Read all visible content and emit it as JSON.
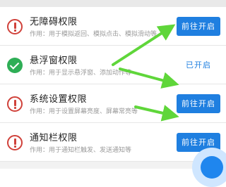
{
  "permissions": [
    {
      "title": "无障碍权限",
      "desc": "作用：用于模拟返回、模拟点击、模拟滑动等",
      "status": "not-enabled",
      "status_icon": "warning-icon",
      "action_label": "前往开启"
    },
    {
      "title": "悬浮窗权限",
      "desc": "作用：用于显示悬浮窗、添加动作等",
      "status": "enabled",
      "status_icon": "check-icon",
      "action_label": "已开启"
    },
    {
      "title": "系统设置权限",
      "desc": "作用：用于设置屏幕亮度、屏幕常亮等",
      "status": "not-enabled",
      "status_icon": "warning-icon",
      "action_label": "前往开启"
    },
    {
      "title": "通知栏权限",
      "desc": "作用：用于通知栏触发、发送通知等",
      "status": "not-enabled",
      "status_icon": "warning-icon",
      "action_label": "前往开启"
    }
  ],
  "colors": {
    "accent": "#1f7fe0",
    "warning": "#d0413a",
    "success": "#2eae56",
    "annotation_arrow": "#5fd63a"
  }
}
